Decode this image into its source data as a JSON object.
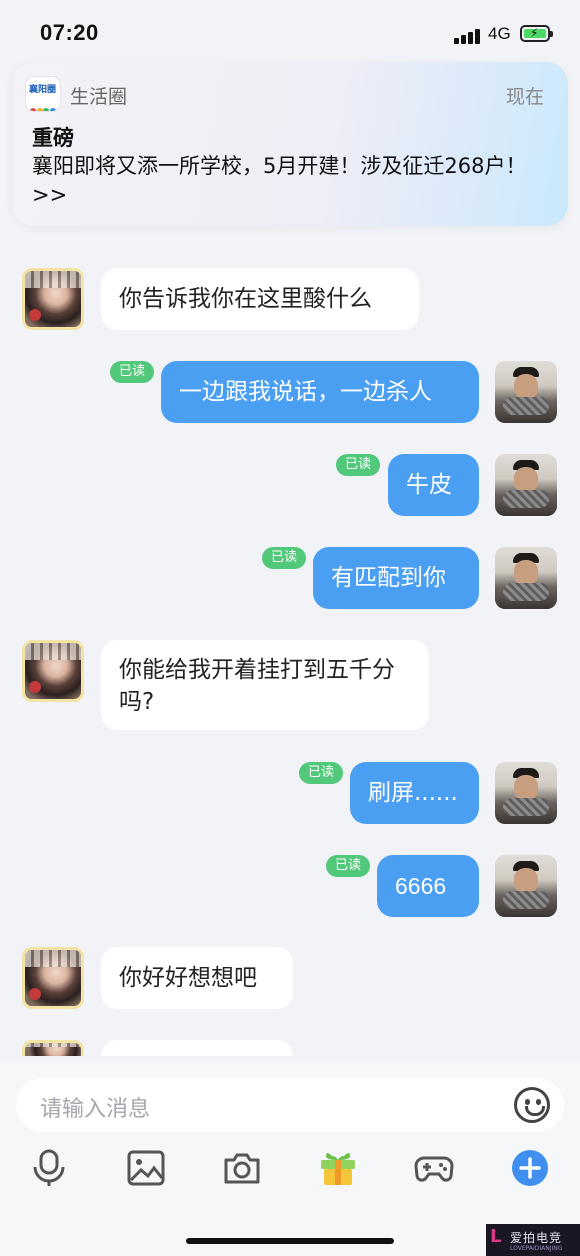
{
  "status_bar": {
    "time": "07:20",
    "network": "4G"
  },
  "notification": {
    "app_icon_text": "襄阳圈",
    "app_name": "生活圈",
    "time": "现在",
    "title": "重磅",
    "body": "襄阳即将又添一所学校，5月开建！涉及征迁268户！ >>"
  },
  "messages": [
    {
      "side": "in",
      "text": "你告诉我你在这里酸什么"
    },
    {
      "side": "out",
      "text": "一边跟我说话，一边杀人",
      "read_label": "已读"
    },
    {
      "side": "out",
      "text": "牛皮",
      "read_label": "已读"
    },
    {
      "side": "out",
      "text": "有匹配到你",
      "read_label": "已读"
    },
    {
      "side": "in",
      "text": "你能给我开着挂打到五千分吗?"
    },
    {
      "side": "out",
      "text": "刷屏......",
      "read_label": "已读"
    },
    {
      "side": "out",
      "text": "6666",
      "read_label": "已读"
    },
    {
      "side": "in",
      "text": "你好好想想吧"
    }
  ],
  "input": {
    "placeholder": "请输入消息"
  },
  "toolbar": {
    "items": [
      "microphone-icon",
      "image-icon",
      "camera-icon",
      "gift-icon",
      "gamepad-icon",
      "plus-icon"
    ]
  },
  "watermark": {
    "logo": "L",
    "brand": "爱拍电竞",
    "url": "LOVEPAIDIANJING"
  },
  "colors": {
    "outgoing_bubble": "#4a9ff2",
    "incoming_bubble": "#ffffff",
    "read_badge": "#52c87a",
    "chat_background": "#f1f3f7"
  }
}
